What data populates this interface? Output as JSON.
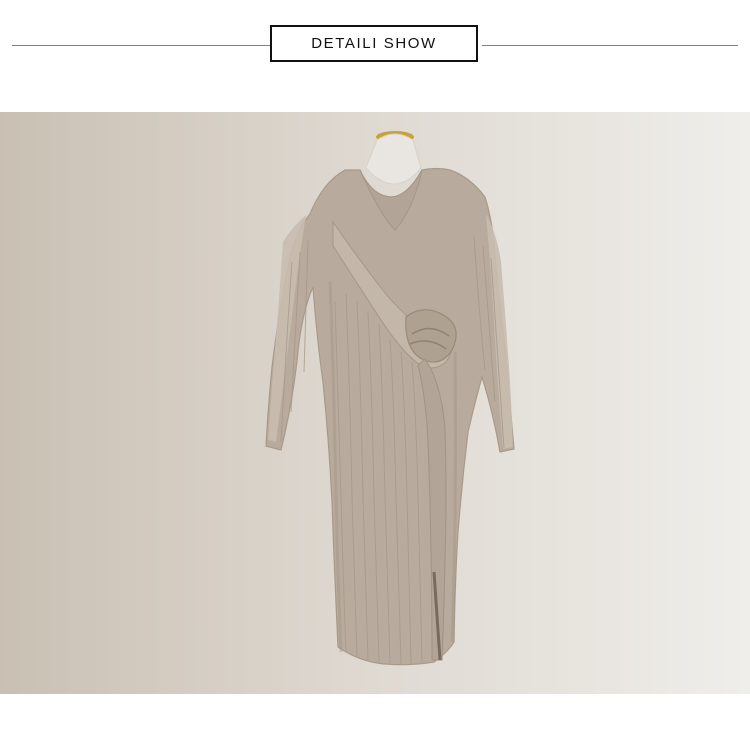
{
  "header": {
    "title": "DETAILI SHOW"
  },
  "photo": {
    "subject": "ribbed-knit-dress-on-mannequin-icon",
    "colors": {
      "background_left": "#c9c0b3",
      "background_mid": "#ddd7cf",
      "background_right": "#efeeea",
      "dress": "#b8ab9d",
      "dress_shadow": "#a59786",
      "dress_highlight": "#cfc4b8",
      "mannequin_neck": "#e9e6e1",
      "mannequin_cap": "#c9a13a"
    }
  }
}
